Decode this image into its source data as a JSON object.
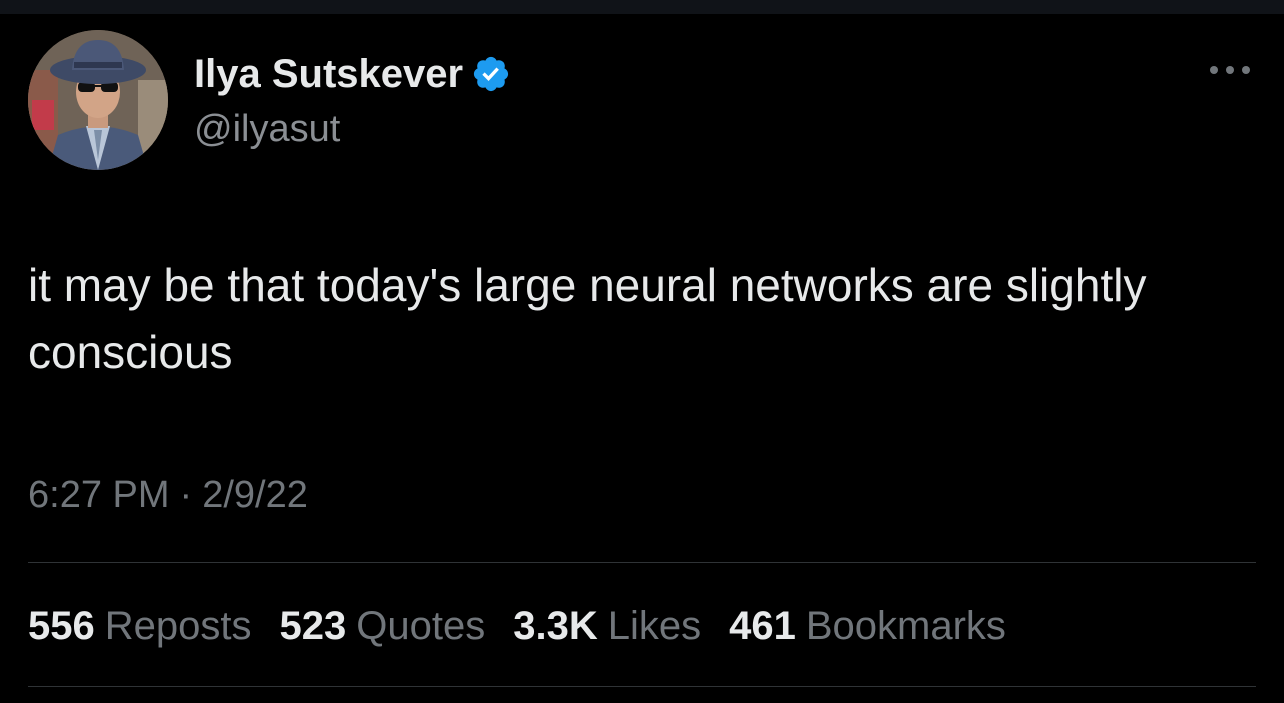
{
  "author": {
    "display_name": "Ilya Sutskever",
    "handle": "@ilyasut",
    "verified": true,
    "avatar_icon": "profile-photo"
  },
  "tweet": {
    "text": "it may be that today's large neural networks are slightly conscious",
    "time": "6:27 PM",
    "separator": "·",
    "date": "2/9/22"
  },
  "stats": [
    {
      "count": "556",
      "label": "Reposts"
    },
    {
      "count": "523",
      "label": "Quotes"
    },
    {
      "count": "3.3K",
      "label": "Likes"
    },
    {
      "count": "461",
      "label": "Bookmarks"
    }
  ],
  "colors": {
    "background": "#000000",
    "primary_text": "#e7e9ea",
    "secondary_text": "#71767b",
    "verified_blue": "#1d9bf0",
    "divider": "#2f3336"
  },
  "icons": {
    "verified": "verified-badge-icon",
    "more": "more-options-icon"
  }
}
